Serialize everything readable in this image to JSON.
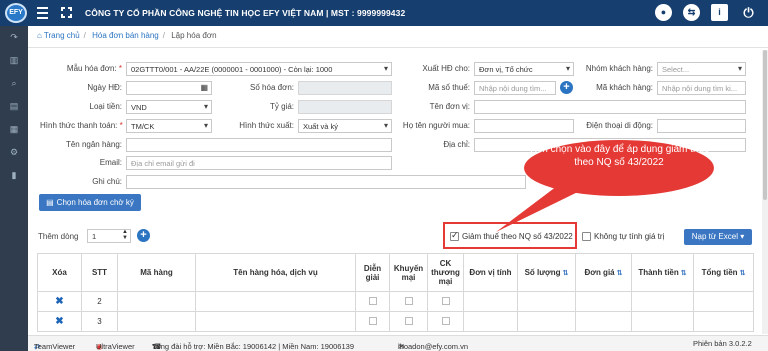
{
  "header": {
    "logo_text": "EFY",
    "company": "CÔNG TY CỔ PHẦN CÔNG NGHỆ TIN HỌC EFY VIỆT NAM | MST : 9999999432",
    "icons": [
      "menu-icon",
      "fullscreen-icon",
      "user-icon",
      "switch-icon",
      "info-icon",
      "power-icon"
    ]
  },
  "breadcrumb": {
    "home": "Trang chủ",
    "sales": "Hóa đơn bán hàng",
    "current": "Lập hóa đơn"
  },
  "form": {
    "template_label": "Mẫu hóa đơn:",
    "template_value": "02GTTT0/001 - AA/22E (0000001 - 0001000) - Còn lại: 1000",
    "invoice_date_label": "Ngày HĐ:",
    "invoice_no_label": "Số hóa đơn:",
    "currency_label": "Loại tiền:",
    "currency_value": "VND",
    "rate_label": "Tỷ giá:",
    "payment_label": "Hình thức thanh toán:",
    "payment_value": "TM/CK",
    "export_form_label": "Hình thức xuất:",
    "export_form_value": "Xuất và ký",
    "bank_label": "Tên ngân hàng:",
    "email_label": "Email:",
    "email_placeholder": "Địa chỉ email gửi đi",
    "note_label": "Ghi chú:",
    "export_for_label": "Xuất HĐ cho:",
    "export_for_value": "Đơn vị, Tổ chức",
    "tax_code_label": "Mã số thuế:",
    "tax_code_placeholder": "Nhập nội dung tìm...",
    "unit_name_label": "Tên đơn vị:",
    "buyer_label": "Họ tên người mua:",
    "address_label": "Địa chỉ:",
    "customer_group_label": "Nhóm khách hàng:",
    "customer_group_placeholder": "Select...",
    "customer_code_label": "Mã khách hàng:",
    "customer_code_placeholder": "Nhập nội dung tìm ki...",
    "phone_label": "Điện thoại di động:"
  },
  "actions": {
    "pending_invoice_button": "Chọn hóa đơn chờ ký",
    "add_rows_label": "Thêm dòng",
    "add_rows_value": "1",
    "tax_reduction_label": "Giảm thuế theo NQ số 43/2022",
    "tax_reduction_checked": true,
    "no_auto_calc_label": "Không tự tính giá trị",
    "import_excel_button": "Nạp từ Excel"
  },
  "callout": {
    "text": "Tích chọn vào đây để áp dụng giảm thuế theo NQ số 43/2022",
    "color": "#e53935"
  },
  "table": {
    "headers": [
      "Xóa",
      "STT",
      "Mã hàng",
      "Tên hàng hóa, dịch vụ",
      "Diễn giải",
      "Khuyến mại",
      "CK thương mại",
      "Đơn vị tính",
      "Số lượng",
      "Đơn giá",
      "Thành tiền",
      "Tổng tiền"
    ],
    "rows": [
      {
        "stt": "2"
      },
      {
        "stt": "3"
      }
    ]
  },
  "footer": {
    "teamviewer": "TeamViewer",
    "ultraviewer": "UltraViewer",
    "hotline": "Tổng đài hỗ trợ: Miền Bắc: 19006142 | Miền Nam: 19006139",
    "email": "ihoadon@efy.com.vn",
    "version": "Phiên bản 3.0.2.2"
  },
  "colors": {
    "header": "#163e6e",
    "sidebar": "#2f3d4e",
    "accent": "#3a76c2",
    "highlight": "#e53935"
  }
}
